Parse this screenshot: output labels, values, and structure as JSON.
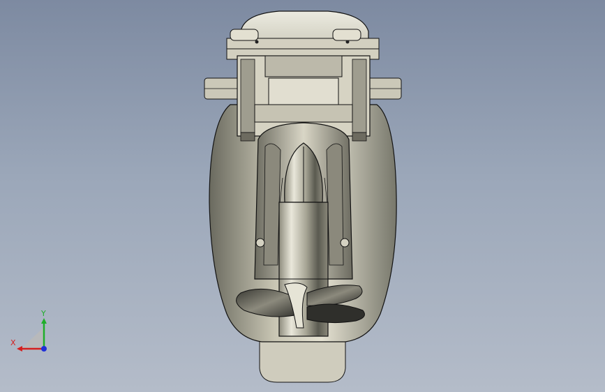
{
  "viewport": {
    "background_top": "#7d8aa1",
    "background_bottom": "#b4bcc9"
  },
  "model": {
    "body_color": "#d8d5c6",
    "shade_color": "#55554c",
    "edge_color": "#111111"
  },
  "triad": {
    "x_label": "X",
    "y_label": "Y",
    "x_color": "#d42020",
    "y_color": "#1fae2a",
    "z_color": "#2030d8"
  }
}
